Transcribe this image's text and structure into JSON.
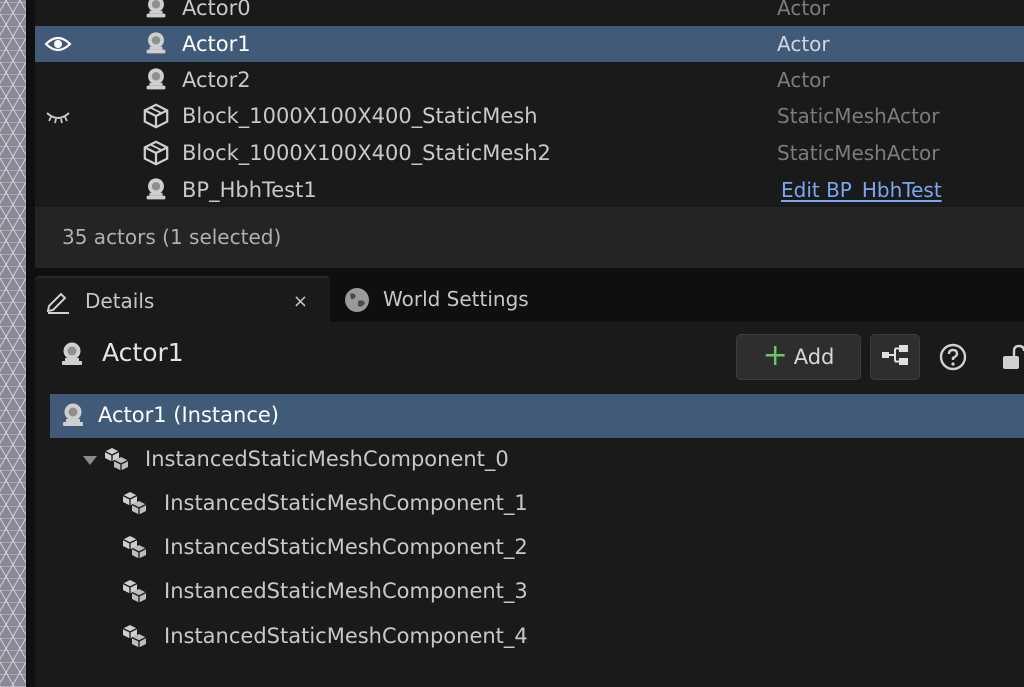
{
  "outliner": {
    "rows": [
      {
        "label": "Actor0",
        "type": "Actor",
        "icon": "actor-icon",
        "visibility": ""
      },
      {
        "label": "Actor1",
        "type": "Actor",
        "icon": "actor-icon",
        "visibility": "visible-eye-icon"
      },
      {
        "label": "Actor2",
        "type": "Actor",
        "icon": "actor-icon",
        "visibility": ""
      },
      {
        "label": "Block_1000X100X400_StaticMesh",
        "type": "StaticMeshActor",
        "icon": "static-mesh-icon",
        "visibility": "hidden-eye-icon"
      },
      {
        "label": "Block_1000X100X400_StaticMesh2",
        "type": "StaticMeshActor",
        "icon": "static-mesh-icon",
        "visibility": ""
      },
      {
        "label": "BP_HbhTest1",
        "type": "Edit BP_HbhTest",
        "icon": "actor-icon",
        "visibility": ""
      }
    ],
    "status": "35 actors (1 selected)"
  },
  "tabs": {
    "details_label": "Details",
    "close_glyph": "×",
    "world_settings_label": "World Settings"
  },
  "details": {
    "title": "Actor1",
    "add_label": "Add",
    "add_glyph": "+",
    "components": [
      {
        "label": "Actor1 (Instance)"
      },
      {
        "label": "InstancedStaticMeshComponent_0"
      },
      {
        "label": "InstancedStaticMeshComponent_1"
      },
      {
        "label": "InstancedStaticMeshComponent_2"
      },
      {
        "label": "InstancedStaticMeshComponent_3"
      },
      {
        "label": "InstancedStaticMeshComponent_4"
      }
    ]
  },
  "colors": {
    "selection": "#415a78",
    "panel": "#1a1a1a",
    "link": "#7aa7f0",
    "add_plus": "#64c864"
  }
}
